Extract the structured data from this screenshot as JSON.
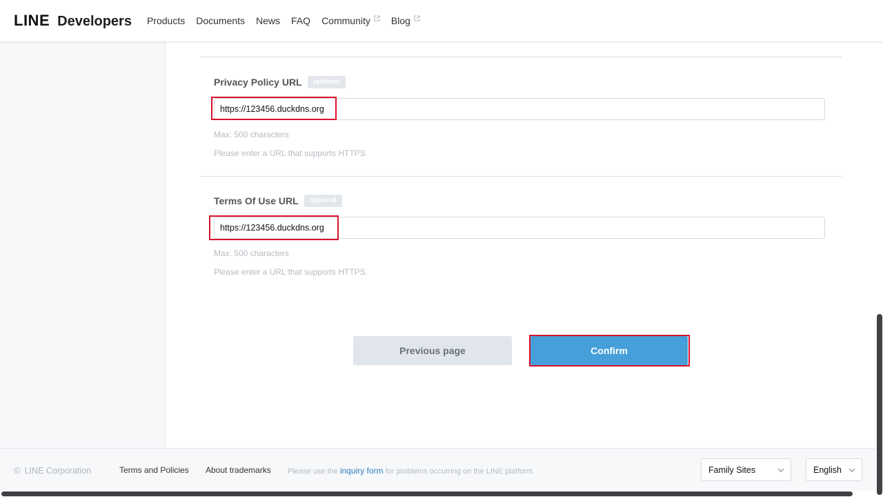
{
  "header": {
    "logo_line": "LINE",
    "logo_developers": "Developers",
    "nav": [
      {
        "label": "Products",
        "external": false
      },
      {
        "label": "Documents",
        "external": false
      },
      {
        "label": "News",
        "external": false
      },
      {
        "label": "FAQ",
        "external": false
      },
      {
        "label": "Community",
        "external": true
      },
      {
        "label": "Blog",
        "external": true
      }
    ]
  },
  "form": {
    "privacy": {
      "label": "Privacy Policy URL",
      "badge": "optional",
      "value": "https://123456.duckdns.org",
      "max_help": "Max: 500 characters",
      "https_help": "Please enter a URL that supports HTTPS."
    },
    "terms": {
      "label": "Terms Of Use URL",
      "badge": "optional",
      "value": "https://123456.duckdns.org",
      "max_help": "Max: 500 characters",
      "https_help": "Please enter a URL that supports HTTPS."
    },
    "prev_label": "Previous page",
    "confirm_label": "Confirm"
  },
  "footer": {
    "copyright_symbol": "©",
    "copyright": "LINE Corporation",
    "terms": "Terms and Policies",
    "trademarks": "About trademarks",
    "note_prefix": "Please use the ",
    "note_link": "inquiry form",
    "note_suffix": " for problems occurring on the LINE platform.",
    "family_sites": "Family Sites",
    "language": "English"
  },
  "colors": {
    "accent": "#469fd9",
    "highlight": "#d9112c",
    "link": "#2d7fc1"
  }
}
